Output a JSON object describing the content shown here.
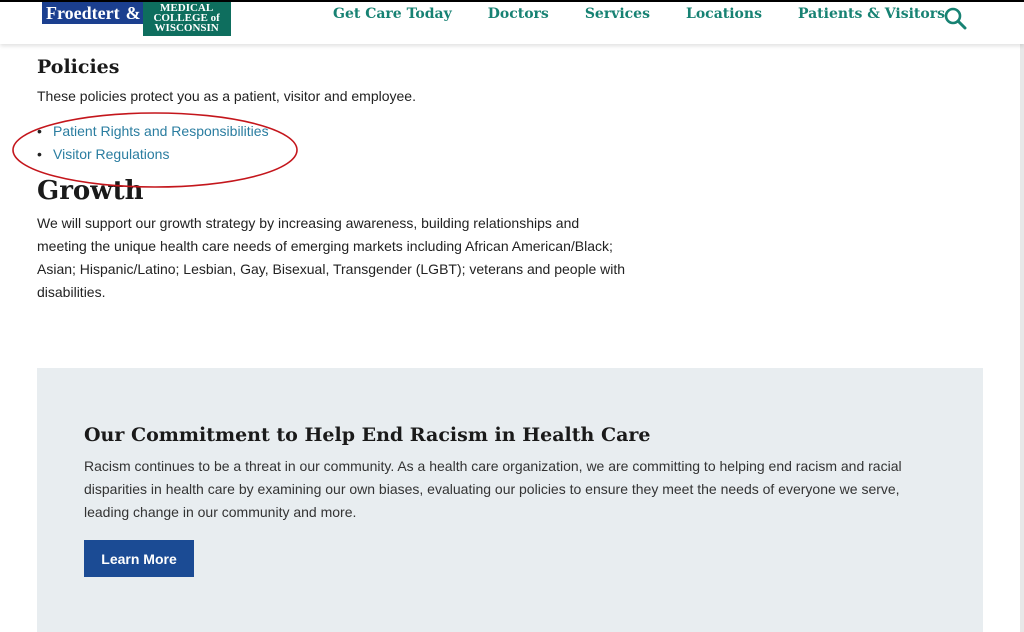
{
  "header": {
    "logo": {
      "left": "Froedtert",
      "amp": "&",
      "right": "MEDICAL COLLEGE of WISCONSIN"
    },
    "nav": [
      "Get Care Today",
      "Doctors",
      "Services",
      "Locations",
      "Patients & Visitors"
    ],
    "search_icon": "search-icon"
  },
  "policies": {
    "title": "Policies",
    "text": "These policies protect you as a patient, visitor and employee.",
    "links": [
      "Patient Rights and Responsibilities",
      "Visitor Regulations"
    ]
  },
  "growth": {
    "title": "Growth",
    "text": "We will support our growth strategy by increasing awareness, building relationships and meeting the unique health care needs of emerging markets including African American/Black; Asian; Hispanic/Latino; Lesbian, Gay, Bisexual, Transgender (LGBT); veterans and people with disabilities."
  },
  "commitment": {
    "title": "Our Commitment to Help End Racism in Health Care",
    "text": "Racism continues to be a threat in our community. As a health care organization, we are committing to helping end racism and racial disparities in health care by examining our own biases, evaluating our policies to ensure they meet the needs of everyone we serve, leading change in our community and more.",
    "button": "Learn More"
  },
  "colors": {
    "nav": "#178273",
    "link": "#2a7da0",
    "button": "#1b4b94",
    "box": "#e8edf0",
    "annotation": "#c4161c"
  }
}
